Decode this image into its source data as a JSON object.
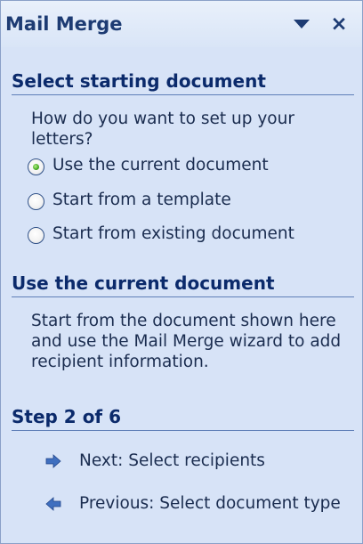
{
  "pane": {
    "title": "Mail Merge",
    "close_glyph": "×",
    "icons": {
      "dropdown": "chevron-down-icon",
      "close": "close-icon"
    }
  },
  "section1": {
    "heading": "Select starting document",
    "question": "How do you want to set up your letters?",
    "options": [
      {
        "label": "Use the current document",
        "selected": true
      },
      {
        "label": "Start from a template",
        "selected": false
      },
      {
        "label": "Start from existing document",
        "selected": false
      }
    ]
  },
  "section2": {
    "heading": "Use the current document",
    "description": "Start from the document shown here and use the Mail Merge wizard to add recipient information."
  },
  "step": {
    "heading": "Step 2 of 6",
    "next": {
      "label": "Next: Select recipients",
      "icon": "arrow-right-icon"
    },
    "previous": {
      "label": "Previous: Select document type",
      "icon": "arrow-left-icon"
    }
  },
  "colors": {
    "pane_bg": "#d7e3f7",
    "heading": "#0b2a6b",
    "text": "#1a2c4f",
    "arrow": "#3f6fbf"
  }
}
